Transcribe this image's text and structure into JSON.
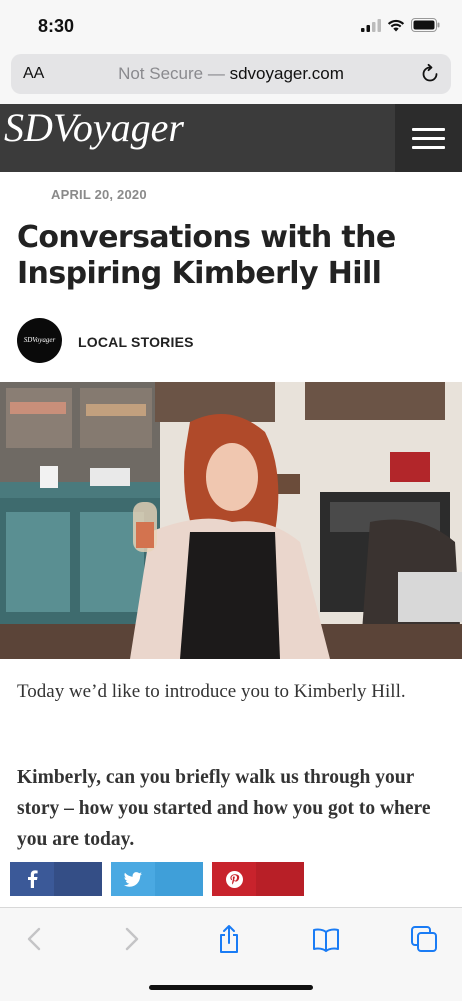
{
  "status_bar": {
    "time": "8:30"
  },
  "browser": {
    "aa_label": "AA",
    "url_prefix": "Not Secure — ",
    "url_domain": "sdvoyager.com"
  },
  "site": {
    "logo": "SDVoyager"
  },
  "article": {
    "date": "APRIL 20, 2020",
    "title": "Conversations with the Inspiring Kimberly Hill",
    "avatar_text": "SDVoyager",
    "category": "LOCAL STORIES",
    "intro": "Today we’d like to introduce you to Kimberly Hill.",
    "question": "Kimberly, can you briefly walk us through your story – how you started and how you got to where you are today."
  },
  "share": [
    {
      "network": "facebook",
      "glyph": "f",
      "color": "#3b5998",
      "dark": "#344e86"
    },
    {
      "network": "twitter",
      "glyph": "t",
      "color": "#4aa9e2",
      "dark": "#3f9fd9"
    },
    {
      "network": "pinterest",
      "glyph": "p",
      "color": "#c8232c",
      "dark": "#b81f27"
    }
  ],
  "colors": {
    "header_bg": "#3b3b3b",
    "menu_bg": "#2c2c2c",
    "browser_blue": "#1a7cf5"
  }
}
